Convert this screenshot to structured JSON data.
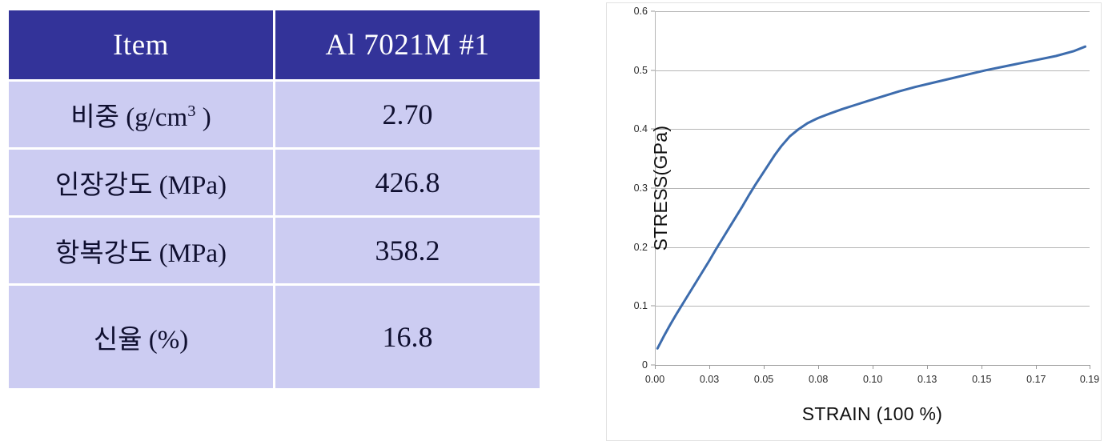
{
  "table": {
    "headers": [
      "Item",
      "Al 7021M #1"
    ],
    "rows": [
      {
        "item": "비중 (g/cm",
        "item_sup": "3",
        "item_tail": " )",
        "value": "2.70"
      },
      {
        "item": "인장강도 (MPa)",
        "item_sup": "",
        "item_tail": "",
        "value": "426.8"
      },
      {
        "item": "항복강도 (MPa)",
        "item_sup": "",
        "item_tail": "",
        "value": "358.2"
      },
      {
        "item": "신율 (%)",
        "item_sup": "",
        "item_tail": "",
        "value": "16.8"
      }
    ],
    "header_color": "#333399",
    "cell_color": "#ccccf2"
  },
  "chart_data": {
    "type": "line",
    "title": "",
    "xlabel": "STRAIN (100 %)",
    "ylabel": "STRESS(GPa)",
    "xlim": [
      0.0,
      0.1995
    ],
    "ylim": [
      0,
      0.6
    ],
    "grid": true,
    "legend": false,
    "line_color": "#3d6cad",
    "line_width": 3,
    "ytick_labels": [
      "0.6",
      "0.5",
      "0.4",
      "0.3",
      "0.2",
      "0.1",
      "0"
    ],
    "ytick_values": [
      0.6,
      0.5,
      0.4,
      0.3,
      0.2,
      0.1,
      0
    ],
    "xtick_labels": [
      "0.00",
      "0.03",
      "0.05",
      "0.08",
      "0.10",
      "0.13",
      "0.15",
      "0.17",
      "0.19"
    ],
    "xtick_values": [
      0.0,
      0.025,
      0.05,
      0.075,
      0.1,
      0.125,
      0.15,
      0.175,
      0.1995
    ],
    "series": [
      {
        "name": "Al 7021M #1",
        "x": [
          0.0012,
          0.004,
          0.007,
          0.01,
          0.013,
          0.016,
          0.019,
          0.022,
          0.025,
          0.028,
          0.031,
          0.034,
          0.037,
          0.04,
          0.043,
          0.046,
          0.049,
          0.052,
          0.055,
          0.058,
          0.062,
          0.066,
          0.07,
          0.075,
          0.08,
          0.086,
          0.092,
          0.098,
          0.105,
          0.112,
          0.12,
          0.128,
          0.136,
          0.144,
          0.152,
          0.16,
          0.168,
          0.176,
          0.184,
          0.192,
          0.1975
        ],
        "y": [
          0.028,
          0.048,
          0.068,
          0.087,
          0.105,
          0.123,
          0.141,
          0.159,
          0.177,
          0.196,
          0.214,
          0.232,
          0.25,
          0.268,
          0.287,
          0.305,
          0.322,
          0.339,
          0.356,
          0.371,
          0.388,
          0.4,
          0.41,
          0.419,
          0.426,
          0.434,
          0.441,
          0.448,
          0.456,
          0.464,
          0.472,
          0.479,
          0.486,
          0.493,
          0.5,
          0.506,
          0.512,
          0.518,
          0.524,
          0.532,
          0.54
        ]
      }
    ]
  }
}
